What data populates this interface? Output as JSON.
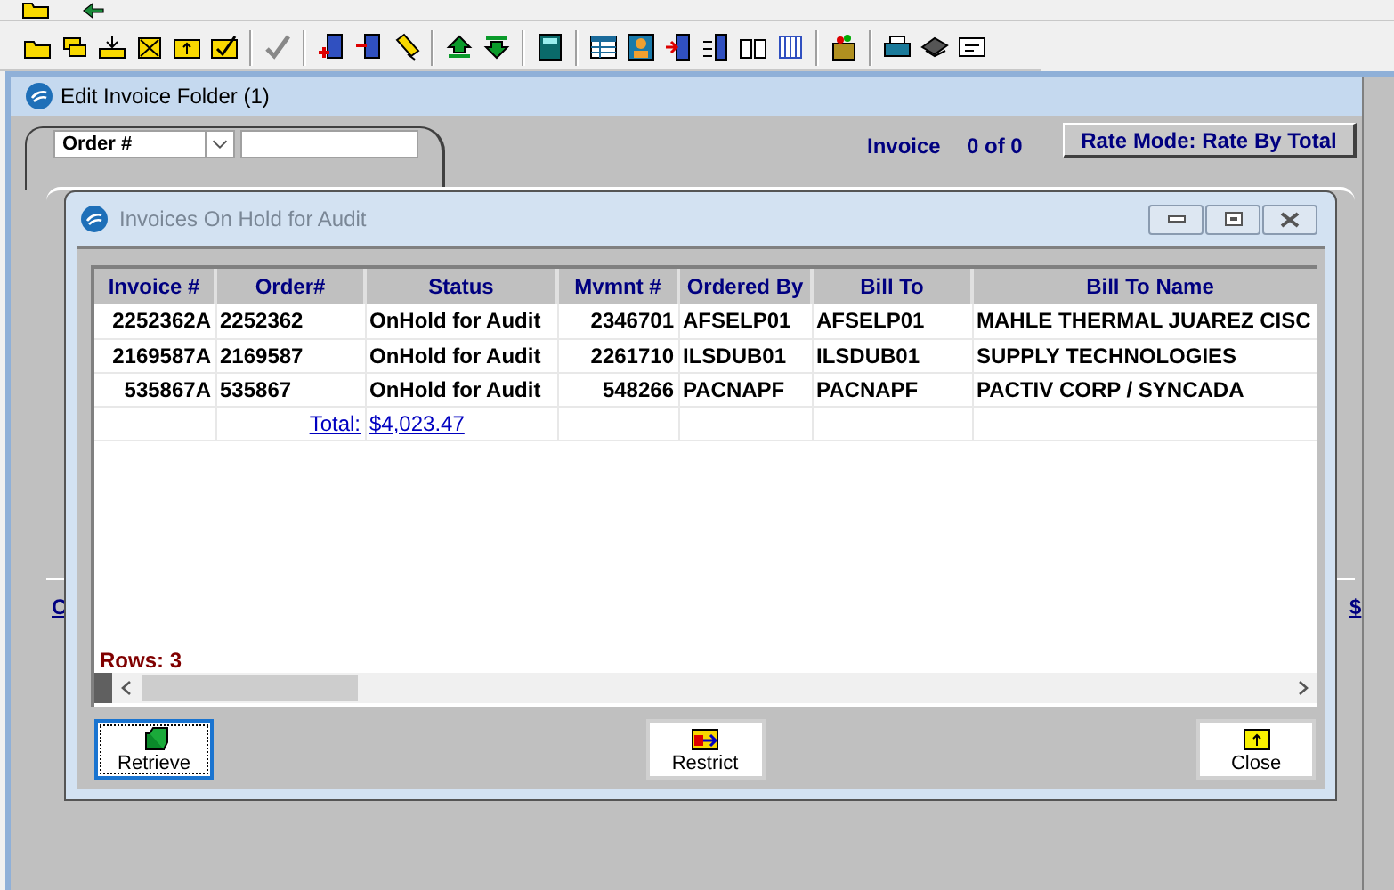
{
  "main_window": {
    "title": "Edit Invoice Folder (1)",
    "search_by": "Order #",
    "invoice_label": "Invoice",
    "invoice_count": "0 of 0",
    "rate_mode_button": "Rate Mode: Rate By Total",
    "behind_left": "C",
    "behind_right": "$"
  },
  "dialog": {
    "title": "Invoices On Hold for Audit",
    "table": {
      "columns": [
        "Invoice #",
        "Order#",
        "Status",
        "Mvmnt #",
        "Ordered By",
        "Bill To",
        "Bill To Name"
      ],
      "rows": [
        {
          "cells": [
            "2252362A",
            "2252362",
            "OnHold for Audit",
            "2346701",
            "AFSELP01",
            "AFSELP01",
            "MAHLE THERMAL JUAREZ CISC"
          ]
        },
        {
          "cells": [
            "2169587A",
            "2169587",
            "OnHold for Audit",
            "2261710",
            "ILSDUB01",
            "ILSDUB01",
            "SUPPLY TECHNOLOGIES"
          ]
        },
        {
          "cells": [
            "535867A",
            "535867",
            "OnHold for Audit",
            "548266",
            "PACNAPF",
            "PACNAPF",
            "PACTIV CORP / SYNCADA"
          ]
        }
      ],
      "total_label": "Total:",
      "total_value": "$4,023.47"
    },
    "rows_count": "Rows: 3",
    "buttons": [
      {
        "label": "Retrieve",
        "kind": "retrieve",
        "focused": true
      },
      {
        "label": "Restrict",
        "kind": "restrict",
        "focused": false
      },
      {
        "label": "Close",
        "kind": "close",
        "focused": false
      }
    ]
  }
}
